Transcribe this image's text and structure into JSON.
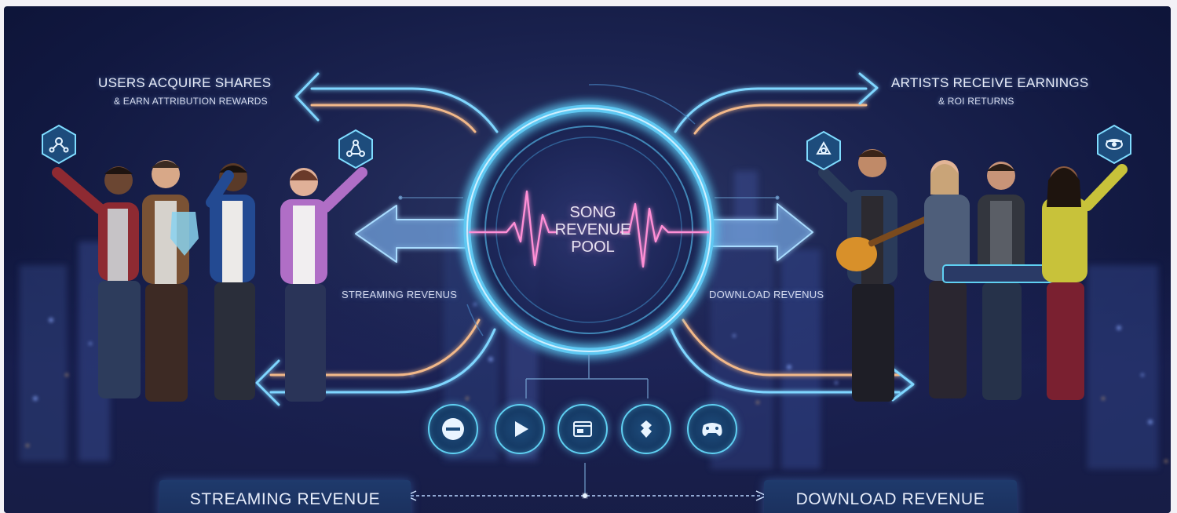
{
  "diagram": {
    "center": {
      "line1": "SONG",
      "line2": "REVENUE",
      "line3": "POOL"
    },
    "left_top": {
      "title": "USERS ACQUIRE SHARES",
      "subtitle": "& EARN ATTRIBUTION REWARDS"
    },
    "right_top": {
      "title": "ARTISTS RECEIVE EARNINGS",
      "subtitle": "& ROI RETURNS"
    },
    "left_mid": "STREAMING REVENUS",
    "right_mid": "DOWNLOAD REVENUS",
    "bottom_left": "STREAMING REVENUE",
    "bottom_right": "DOWNLOAD REVENUE",
    "platform_icons": [
      "minus-circle-icon",
      "play-icon",
      "browser-window-icon",
      "badge-icon",
      "gamepad-icon"
    ],
    "hex_icons": [
      "users-share-icon",
      "network-icon",
      "recycle-icon",
      "vinyl-icon"
    ]
  },
  "colors": {
    "background": "#151c48",
    "glow_cyan": "#6fd8ff",
    "glow_orange": "#f2b889",
    "pulse_pink": "#ff7fd0",
    "box_blue": "#1f3a6c"
  }
}
